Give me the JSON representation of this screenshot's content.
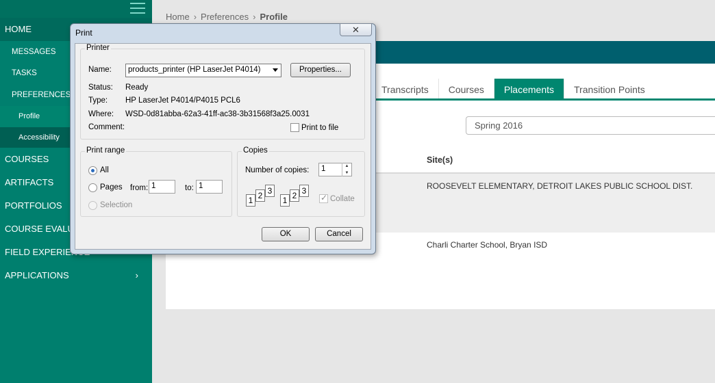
{
  "sidebar": {
    "home": "HOME",
    "messages": "MESSAGES",
    "tasks": "TASKS",
    "preferences": "PREFERENCES",
    "profile": "Profile",
    "accessibility": "Accessibility",
    "courses": "COURSES",
    "artifacts": "ARTIFACTS",
    "portfolios": "PORTFOLIOS",
    "course_eval": "COURSE EVALU",
    "field_exp": "FIELD EXPERIENCE",
    "applications": "APPLICATIONS"
  },
  "breadcrumb": {
    "home": "Home",
    "preferences": "Preferences",
    "profile": "Profile",
    "sep": "›"
  },
  "tabs": [
    "Transcripts",
    "Courses",
    "Placements",
    "Transition Points"
  ],
  "term": "Spring 2016",
  "table": {
    "sites_header": "Site(s)",
    "rows": [
      "ROOSEVELT ELEMENTARY, DETROIT LAKES PUBLIC SCHOOL DIST.",
      "Charli Charter School, Bryan ISD"
    ]
  },
  "dialog": {
    "title": "Print",
    "close_glyph": "✕",
    "printer_group": "Printer",
    "name_label": "Name:",
    "name_value": "products_printer (HP LaserJet P4014)",
    "properties": "Properties...",
    "status_label": "Status:",
    "status_value": "Ready",
    "type_label": "Type:",
    "type_value": "HP LaserJet P4014/P4015 PCL6",
    "where_label": "Where:",
    "where_value": "WSD-0d81abba-62a3-41ff-ac38-3b31568f3a25.0031",
    "comment_label": "Comment:",
    "print_to_file": "Print to file",
    "range_group": "Print range",
    "all": "All",
    "pages": "Pages",
    "from": "from:",
    "from_value": "1",
    "to": "to:",
    "to_value": "1",
    "selection": "Selection",
    "copies_group": "Copies",
    "num_copies": "Number of copies:",
    "copies_value": "1",
    "collate": "Collate",
    "collate_digits": [
      "1",
      "2",
      "3"
    ],
    "ok": "OK",
    "cancel": "Cancel"
  }
}
